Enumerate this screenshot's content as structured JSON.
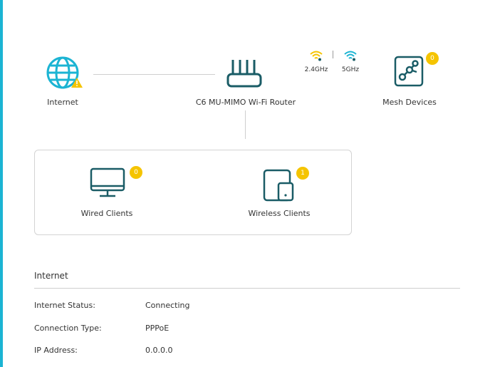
{
  "topology": {
    "internet": {
      "label": "Internet",
      "status": "warning"
    },
    "router": {
      "label": "C6 MU-MIMO Wi-Fi Router"
    },
    "bands": [
      {
        "label": "2.4GHz",
        "color": "#f5c400"
      },
      {
        "label": "5GHz",
        "color": "#1bb4d3"
      }
    ],
    "mesh": {
      "label": "Mesh Devices",
      "count": "0"
    },
    "wired_clients": {
      "label": "Wired Clients",
      "count": "0"
    },
    "wireless_clients": {
      "label": "Wireless Clients",
      "count": "1"
    }
  },
  "internet_section": {
    "title": "Internet",
    "rows": [
      {
        "label": "Internet Status:",
        "value": "Connecting"
      },
      {
        "label": "Connection Type:",
        "value": "PPPoE"
      },
      {
        "label": "IP Address:",
        "value": "0.0.0.0"
      }
    ]
  },
  "colors": {
    "accent": "#1bb4d3",
    "icon_dark": "#1a5c66",
    "badge": "#f5c400",
    "warning": "#f5c400"
  }
}
